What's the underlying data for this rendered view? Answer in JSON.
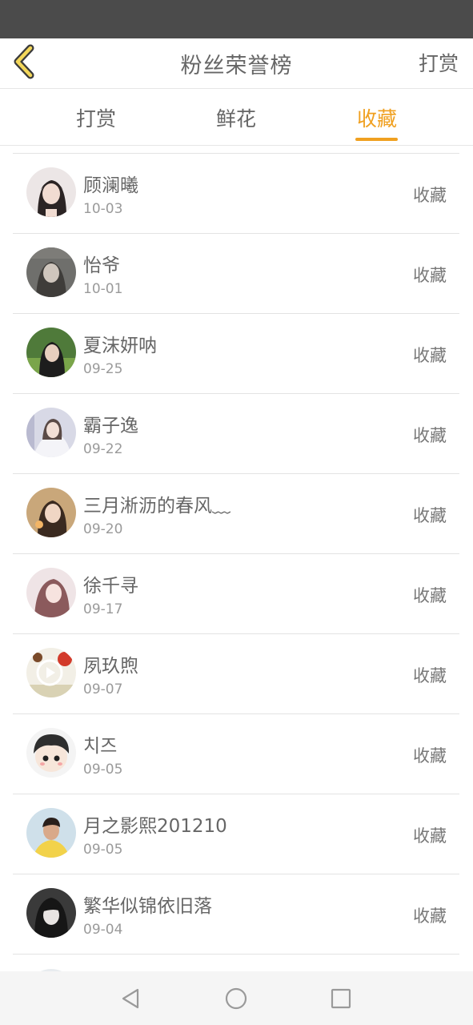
{
  "header": {
    "title": "粉丝荣誉榜",
    "action_label": "打赏"
  },
  "tabs": [
    {
      "label": "打赏",
      "active": false
    },
    {
      "label": "鲜花",
      "active": false
    },
    {
      "label": "收藏",
      "active": true
    }
  ],
  "accent_color": "#f0a020",
  "fans": [
    {
      "name": "顾澜曦",
      "date": "10-03",
      "action": "收藏"
    },
    {
      "name": "怡爷",
      "date": "10-01",
      "action": "收藏"
    },
    {
      "name": "夏沫妍呐",
      "date": "09-25",
      "action": "收藏"
    },
    {
      "name": "霸子逸",
      "date": "09-22",
      "action": "收藏"
    },
    {
      "name": "三月淅沥的春风﹏",
      "date": "09-20",
      "action": "收藏"
    },
    {
      "name": "徐千寻",
      "date": "09-17",
      "action": "收藏"
    },
    {
      "name": "夙玖煦",
      "date": "09-07",
      "action": "收藏"
    },
    {
      "name": "치즈",
      "date": "09-05",
      "action": "收藏"
    },
    {
      "name": "月之影熙201210",
      "date": "09-05",
      "action": "收藏"
    },
    {
      "name": "繁华似锦依旧落",
      "date": "09-04",
      "action": "收藏"
    }
  ],
  "navbar": {
    "icons": [
      "back-triangle-icon",
      "home-circle-icon",
      "recents-square-icon"
    ]
  }
}
